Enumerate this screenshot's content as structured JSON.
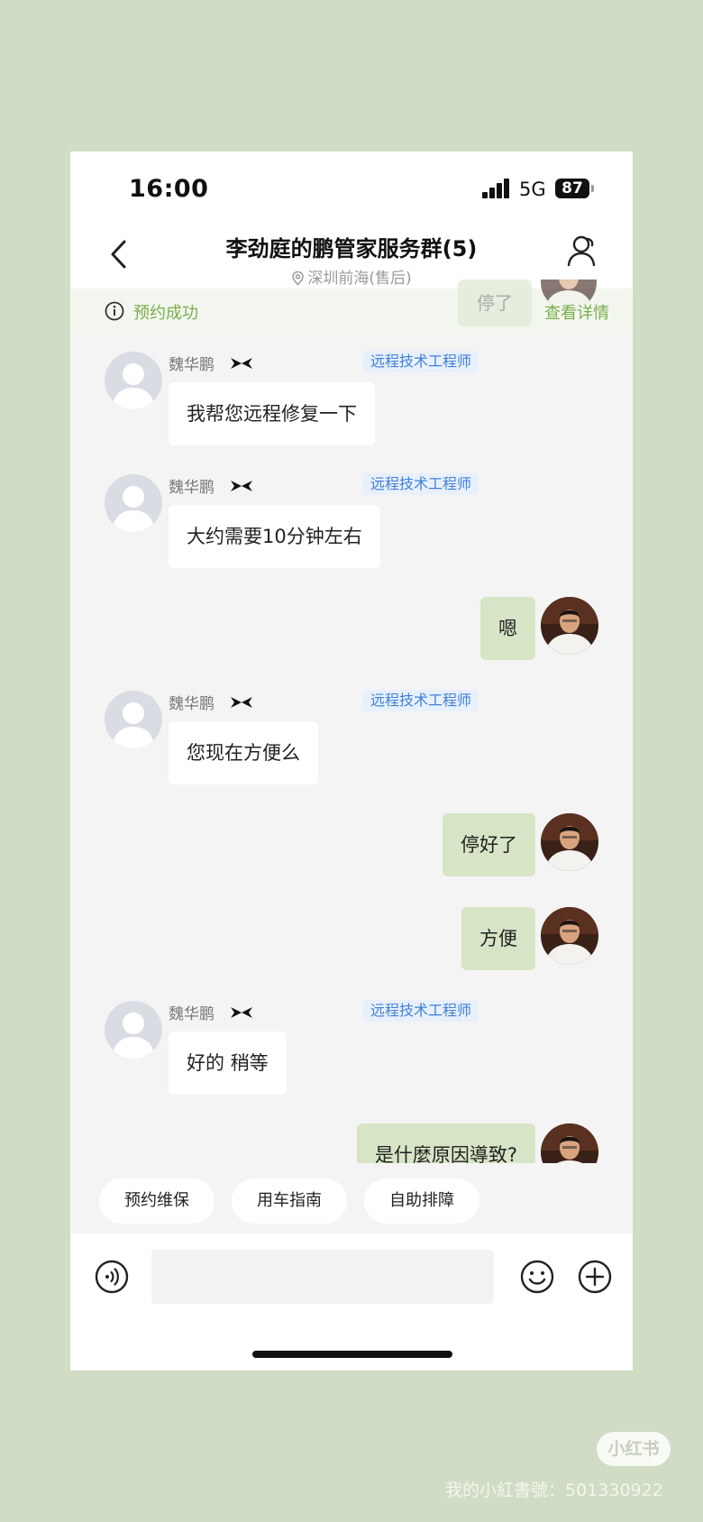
{
  "status_bar": {
    "time": "16:00",
    "network": "5G",
    "battery": "87"
  },
  "header": {
    "title": "李劲庭的鹏管家服务群(5)",
    "location": "深圳前海(售后)"
  },
  "notice": {
    "text": "预约成功",
    "detail_link": "查看详情",
    "behind_text": "停了"
  },
  "messages": [
    {
      "side": "in",
      "sender": "魏华鹏",
      "badge": "远程技术工程师",
      "text": "我帮您远程修复一下"
    },
    {
      "side": "in",
      "sender": "魏华鹏",
      "badge": "远程技术工程师",
      "text": "大约需要10分钟左右"
    },
    {
      "side": "out",
      "text": "嗯"
    },
    {
      "side": "in",
      "sender": "魏华鹏",
      "badge": "远程技术工程师",
      "text": "您现在方便么"
    },
    {
      "side": "out",
      "text": "停好了"
    },
    {
      "side": "out",
      "text": "方便"
    },
    {
      "side": "in",
      "sender": "魏华鹏",
      "badge": "远程技术工程师",
      "text": "好的 稍等"
    },
    {
      "side": "out",
      "text": "是什麼原因導致?"
    }
  ],
  "quick_actions": [
    "预约维保",
    "用车指南",
    "自助排障"
  ],
  "icons": [
    "back-arrow-icon",
    "location-pin-icon",
    "group-members-icon",
    "info-icon",
    "brand-logo-icon",
    "voice-icon",
    "emoji-icon",
    "plus-icon"
  ],
  "watermark": {
    "logo": "小红书",
    "text": "我的小紅書號：501330922"
  },
  "colors": {
    "background": "#d0dcc4",
    "outgoing_bubble": "#d7e5c6",
    "accent_green": "#7bae4e",
    "badge_blue": "#3f80d8"
  }
}
